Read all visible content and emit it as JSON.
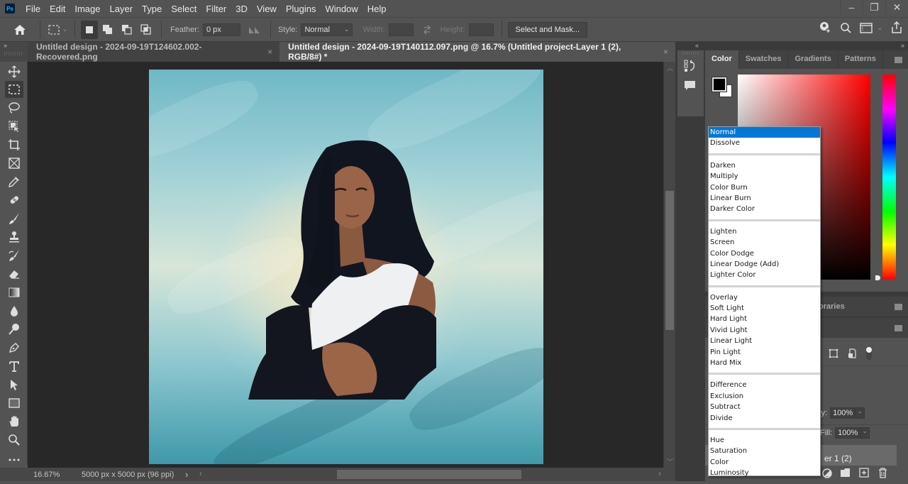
{
  "app": {
    "logo": "Ps",
    "name": "Adobe Photoshop"
  },
  "menubar": {
    "items": [
      "File",
      "Edit",
      "Image",
      "Layer",
      "Type",
      "Select",
      "Filter",
      "3D",
      "View",
      "Plugins",
      "Window",
      "Help"
    ],
    "window_controls": {
      "minimize": "–",
      "restore": "❐",
      "close": "✕"
    }
  },
  "options_bar": {
    "tool_preset_icon": "rectangular-marquee-icon",
    "selection_modes": [
      "new-selection",
      "add-to-selection",
      "subtract-from-selection",
      "intersect-with-selection"
    ],
    "active_mode": "new-selection",
    "feather_label": "Feather:",
    "feather_value": "0 px",
    "style_label": "Style:",
    "style_value": "Normal",
    "width_label": "Width:",
    "width_value": "",
    "height_label": "Height:",
    "height_value": "",
    "select_and_mask": "Select and Mask...",
    "right_icons": [
      "share-user-icon",
      "search-icon",
      "workspace-icon",
      "share-export-icon"
    ]
  },
  "tabs": [
    {
      "title": "Untitled design - 2024-09-19T124602.002-Recovered.png",
      "active": false,
      "close": "×"
    },
    {
      "title": "Untitled design - 2024-09-19T140112.097.png @ 16.7% (Untitled project-Layer 1 (2), RGB/8#) *",
      "active": true,
      "close": "×"
    }
  ],
  "tools": [
    "move",
    "rectangular-marquee",
    "lasso",
    "object-selection",
    "crop",
    "frame",
    "eyedropper",
    "spot-healing-brush",
    "brush",
    "clone-stamp",
    "history-brush",
    "eraser",
    "gradient",
    "blur",
    "dodge",
    "pen",
    "type",
    "path-selection",
    "rectangle",
    "hand",
    "zoom",
    "more-tools"
  ],
  "active_tool": "rectangular-marquee",
  "collapse_left": "»",
  "collapse_right": "»",
  "collapse_dock": "«",
  "status": {
    "zoom": "16.67%",
    "doc_info": "5000 px x 5000 px (96 ppi)",
    "arrow": "›",
    "scroll_left": "‹",
    "scroll_right": "›"
  },
  "color_panel": {
    "tabs": [
      "Color",
      "Swatches",
      "Gradients",
      "Patterns"
    ],
    "active_tab": "Color",
    "foreground": "#000000",
    "background": "#ffffff",
    "hue_base": "#ff0000"
  },
  "libraries_tab_partial": "braries",
  "layers_panel": {
    "opacity_label": "ity:",
    "opacity_value": "100%",
    "fill_label": "Fill:",
    "fill_value": "100%",
    "layer_name_partial": "er 1 (2)"
  },
  "blend_menu": {
    "selected": "Normal",
    "groups": [
      [
        "Normal",
        "Dissolve"
      ],
      [
        "Darken",
        "Multiply",
        "Color Burn",
        "Linear Burn",
        "Darker Color"
      ],
      [
        "Lighten",
        "Screen",
        "Color Dodge",
        "Linear Dodge (Add)",
        "Lighter Color"
      ],
      [
        "Overlay",
        "Soft Light",
        "Hard Light",
        "Vivid Light",
        "Linear Light",
        "Pin Light",
        "Hard Mix"
      ],
      [
        "Difference",
        "Exclusion",
        "Subtract",
        "Divide"
      ],
      [
        "Hue",
        "Saturation",
        "Color",
        "Luminosity"
      ]
    ]
  },
  "colors": {
    "ui_bg": "#535353",
    "canvas_bg": "#282828",
    "highlight": "#0078d7"
  }
}
